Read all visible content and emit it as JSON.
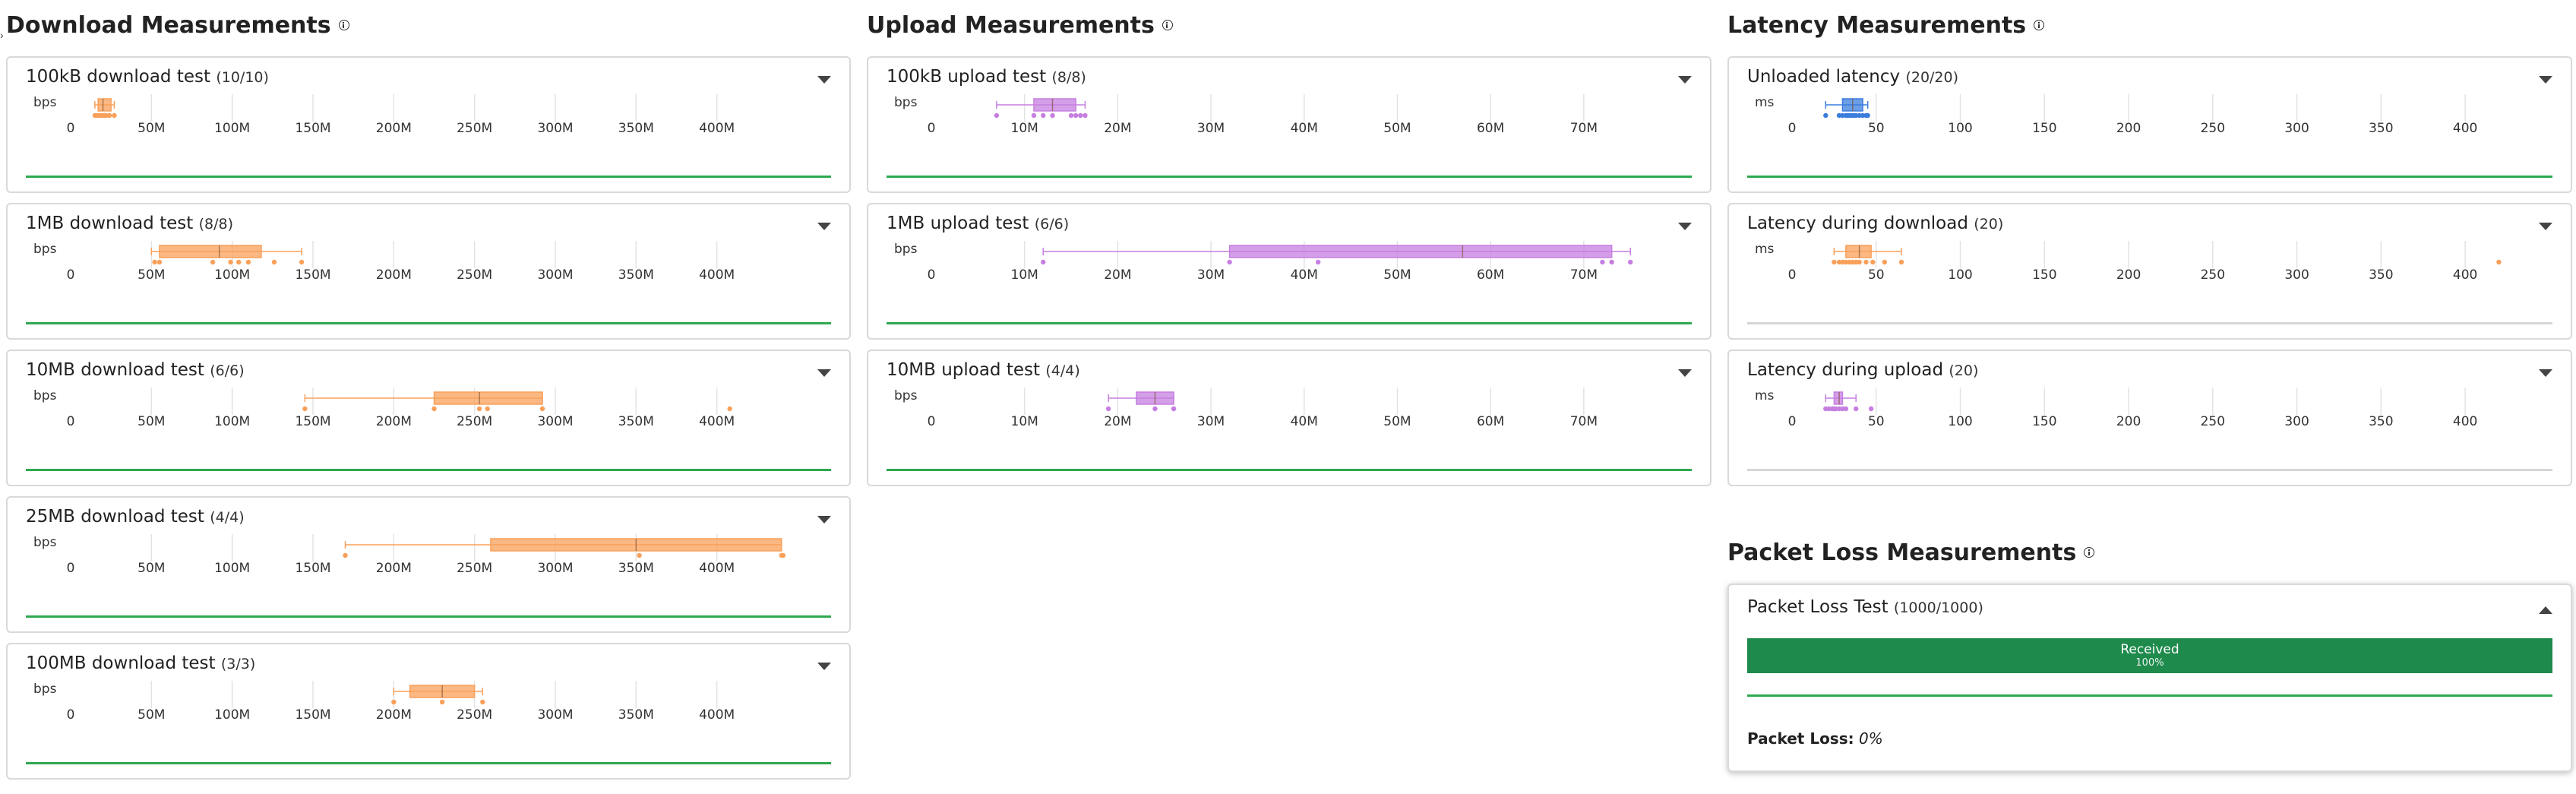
{
  "download": {
    "title": "Download Measurements",
    "unit": "bps",
    "ticks": [
      "0",
      "50M",
      "100M",
      "150M",
      "200M",
      "250M",
      "300M",
      "350M",
      "400M"
    ],
    "tick_values": [
      0,
      50,
      100,
      150,
      200,
      250,
      300,
      350,
      400
    ],
    "max": 450,
    "color": "#f9a05a",
    "line_color": "#2ea84f",
    "tests": [
      {
        "name": "100kB download test",
        "count": "(10/10)",
        "box": {
          "min": 15,
          "q1": 17,
          "median": 20,
          "q3": 25,
          "max": 27
        },
        "points": [
          15,
          16,
          17,
          18,
          19,
          20,
          21,
          22,
          24,
          27
        ]
      },
      {
        "name": "1MB download test",
        "count": "(8/8)",
        "box": {
          "min": 50,
          "q1": 55,
          "median": 92,
          "q3": 118,
          "max": 143
        },
        "points": [
          52,
          55,
          88,
          99,
          104,
          110,
          126,
          143
        ]
      },
      {
        "name": "10MB download test",
        "count": "(6/6)",
        "box": {
          "min": 145,
          "q1": 225,
          "median": 253,
          "q3": 292,
          "max": 292
        },
        "points": [
          145,
          225,
          253,
          258,
          292,
          408
        ]
      },
      {
        "name": "25MB download test",
        "count": "(4/4)",
        "box": {
          "min": 170,
          "q1": 260,
          "median": 350,
          "q3": 440,
          "max": 440
        },
        "points": [
          170,
          352,
          440,
          441
        ]
      },
      {
        "name": "100MB download test",
        "count": "(3/3)",
        "box": {
          "min": 200,
          "q1": 210,
          "median": 230,
          "q3": 250,
          "max": 255
        },
        "points": [
          200,
          230,
          255
        ]
      }
    ]
  },
  "upload": {
    "title": "Upload Measurements",
    "unit": "bps",
    "ticks": [
      "0",
      "10M",
      "20M",
      "30M",
      "40M",
      "50M",
      "60M",
      "70M"
    ],
    "tick_values": [
      0,
      10,
      20,
      30,
      40,
      50,
      60,
      70
    ],
    "max": 78,
    "color": "#c67fe0",
    "line_color": "#2ea84f",
    "tests": [
      {
        "name": "100kB upload test",
        "count": "(8/8)",
        "box": {
          "min": 7,
          "q1": 11,
          "median": 13,
          "q3": 15.5,
          "max": 16.5
        },
        "points": [
          7,
          11,
          12,
          13,
          15,
          15.5,
          16,
          16.5
        ]
      },
      {
        "name": "1MB upload test",
        "count": "(6/6)",
        "box": {
          "min": 12,
          "q1": 32,
          "median": 57,
          "q3": 73,
          "max": 75
        },
        "points": [
          12,
          32,
          41.5,
          72,
          73,
          75
        ]
      },
      {
        "name": "10MB upload test",
        "count": "(4/4)",
        "box": {
          "min": 19,
          "q1": 22,
          "median": 24,
          "q3": 26,
          "max": 26
        },
        "points": [
          19,
          24,
          26,
          26
        ]
      }
    ]
  },
  "latency": {
    "title": "Latency Measurements",
    "unit": "ms",
    "ticks": [
      "0",
      "50",
      "100",
      "150",
      "200",
      "250",
      "300",
      "350",
      "400"
    ],
    "tick_values": [
      0,
      50,
      100,
      150,
      200,
      250,
      300,
      350,
      400
    ],
    "max": 432,
    "line_color": "#2ea84f",
    "tests": [
      {
        "name": "Unloaded latency",
        "count": "(20/20)",
        "color": "#3b7ddd",
        "box": {
          "min": 20,
          "q1": 30,
          "median": 36,
          "q3": 42,
          "max": 45
        },
        "points": [
          20,
          28,
          30,
          32,
          33,
          34,
          35,
          36,
          37,
          38,
          40,
          42,
          44,
          45
        ]
      },
      {
        "name": "Latency during download",
        "count": "(20)",
        "color": "#f9a05a",
        "box": {
          "min": 25,
          "q1": 32,
          "median": 40,
          "q3": 47,
          "max": 65
        },
        "points": [
          25,
          28,
          30,
          32,
          34,
          36,
          38,
          40,
          44,
          48,
          55,
          65,
          420
        ]
      },
      {
        "name": "Latency during upload",
        "count": "(20)",
        "color": "#c67fe0",
        "box": {
          "min": 20,
          "q1": 25,
          "median": 28,
          "q3": 30,
          "max": 38
        },
        "points": [
          20,
          22,
          24,
          25,
          26,
          28,
          30,
          32,
          38,
          47
        ]
      }
    ]
  },
  "packet_loss": {
    "title": "Packet Loss Measurements",
    "test_name": "Packet Loss Test",
    "count": "(1000/1000)",
    "bar_label": "Received",
    "bar_percent": "100%",
    "loss_label": "Packet Loss:",
    "loss_value": "0%",
    "received_fraction": 1.0
  }
}
